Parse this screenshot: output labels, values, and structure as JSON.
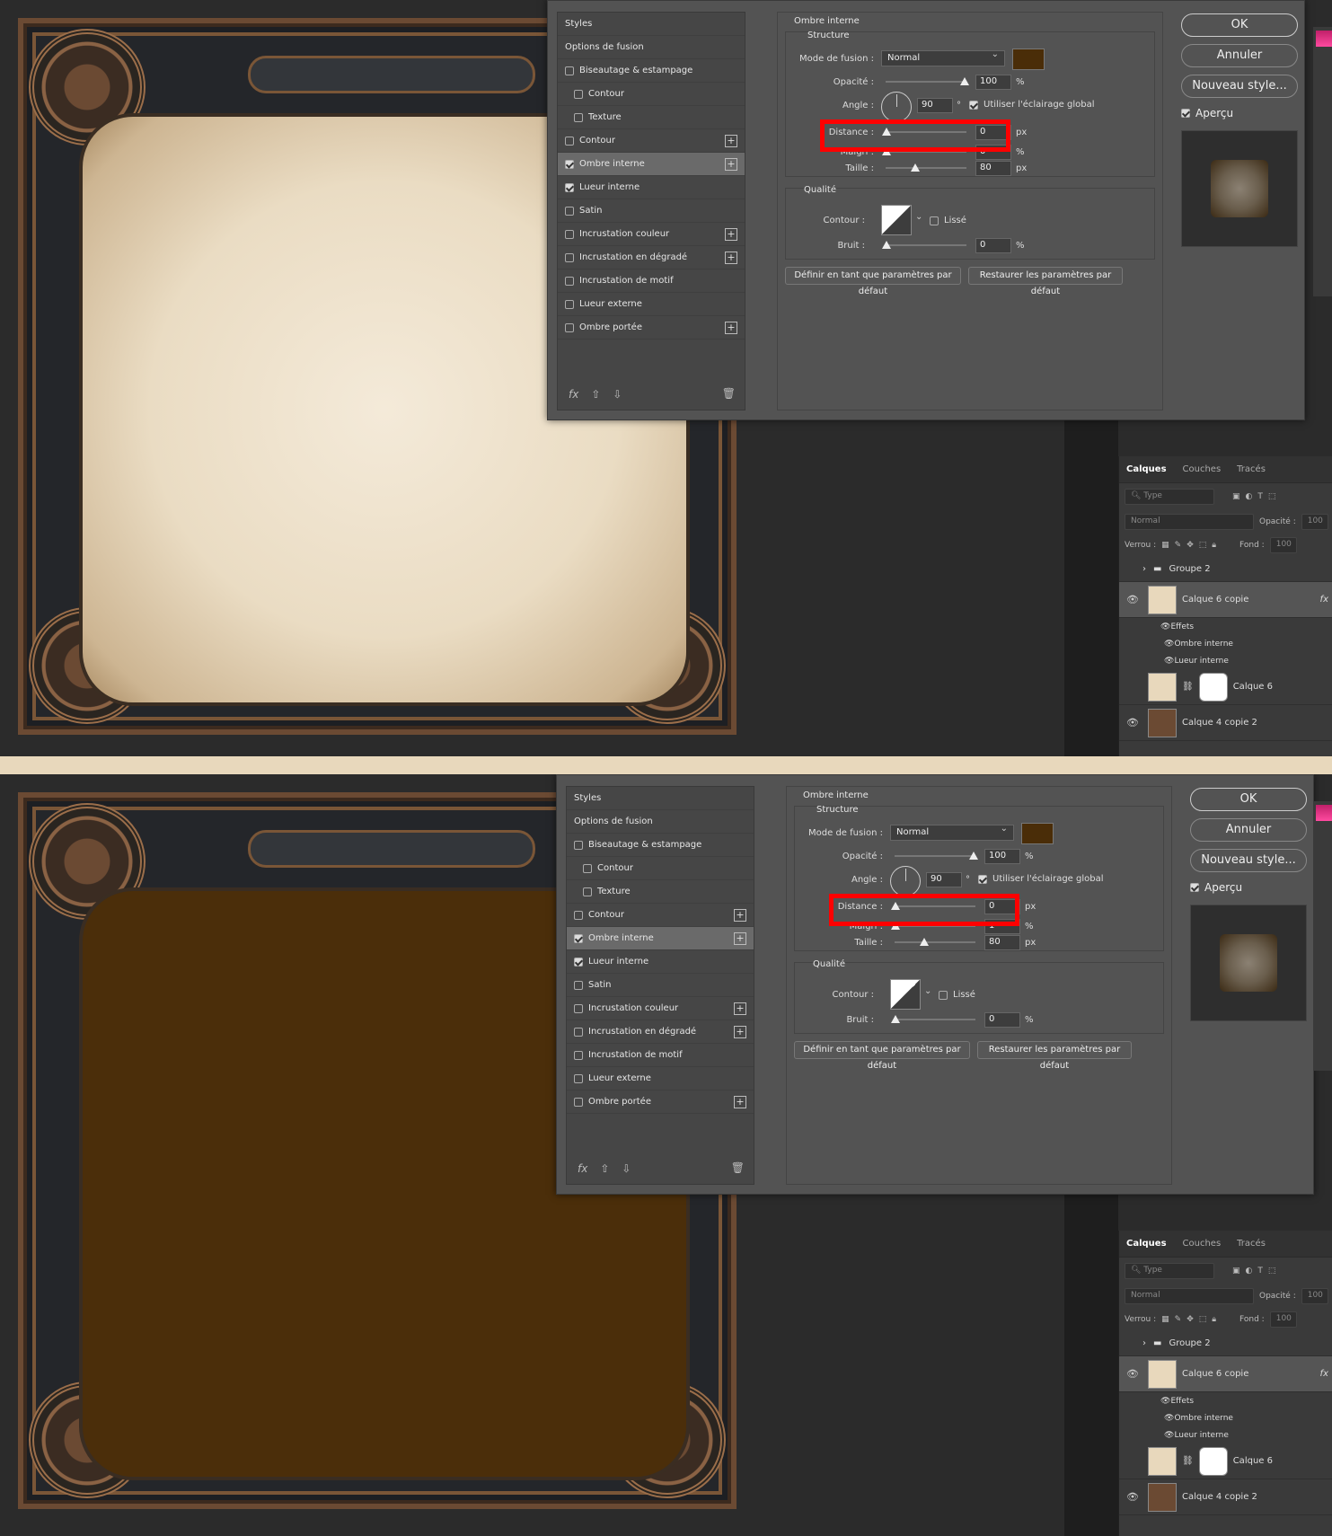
{
  "panels": [
    {
      "section_title": "Ombre interne",
      "structure_title": "Structure",
      "blend_label": "Mode de fusion :",
      "blend_value": "Normal",
      "swatch_color": "#4a2d08",
      "opacity_label": "Opacité :",
      "opacity_value": "100",
      "angle_label": "Angle :",
      "angle_value": "90",
      "global_light_label": "Utiliser l'éclairage global",
      "distance_label": "Distance :",
      "distance_value": "0",
      "maigri_label": "Maigri :",
      "maigri_value": "0",
      "taille_label": "Taille :",
      "taille_value": "80",
      "qualite_title": "Qualité",
      "contour_label": "Contour :",
      "lisse_label": "Lissé",
      "bruit_label": "Bruit :",
      "bruit_value": "0",
      "inner_color": "#efe3cf"
    },
    {
      "section_title": "Ombre interne",
      "structure_title": "Structure",
      "blend_label": "Mode de fusion :",
      "blend_value": "Normal",
      "swatch_color": "#4a2d08",
      "opacity_label": "Opacité :",
      "opacity_value": "100",
      "angle_label": "Angle :",
      "angle_value": "90",
      "global_light_label": "Utiliser l'éclairage global",
      "distance_label": "Distance :",
      "distance_value": "0",
      "maigri_label": "Maigri :",
      "maigri_value": "1",
      "taille_label": "Taille :",
      "taille_value": "80",
      "qualite_title": "Qualité",
      "contour_label": "Contour :",
      "lisse_label": "Lissé",
      "bruit_label": "Bruit :",
      "bruit_value": "0",
      "inner_color": "#4b2e0a"
    }
  ],
  "units": {
    "percent": "%",
    "px": "px",
    "degree": "°"
  },
  "styles_list": {
    "header": "Styles",
    "blend_options": "Options de fusion",
    "items": [
      {
        "label": "Biseautage & estampage",
        "checked": false,
        "sub": false,
        "plus": false
      },
      {
        "label": "Contour",
        "checked": false,
        "sub": true,
        "plus": false
      },
      {
        "label": "Texture",
        "checked": false,
        "sub": true,
        "plus": false
      },
      {
        "label": "Contour",
        "checked": false,
        "sub": false,
        "plus": true
      },
      {
        "label": "Ombre interne",
        "checked": true,
        "sub": false,
        "plus": true,
        "selected": true
      },
      {
        "label": "Lueur interne",
        "checked": true,
        "sub": false,
        "plus": false
      },
      {
        "label": "Satin",
        "checked": false,
        "sub": false,
        "plus": false
      },
      {
        "label": "Incrustation couleur",
        "checked": false,
        "sub": false,
        "plus": true
      },
      {
        "label": "Incrustation en dégradé",
        "checked": false,
        "sub": false,
        "plus": true
      },
      {
        "label": "Incrustation de motif",
        "checked": false,
        "sub": false,
        "plus": false
      },
      {
        "label": "Lueur externe",
        "checked": false,
        "sub": false,
        "plus": false
      },
      {
        "label": "Ombre portée",
        "checked": false,
        "sub": false,
        "plus": true
      }
    ],
    "fx_label": "fx"
  },
  "buttons": {
    "ok": "OK",
    "cancel": "Annuler",
    "new_style": "Nouveau style...",
    "preview": "Aperçu",
    "set_default": "Définir en tant que paramètres par défaut",
    "reset_default": "Restaurer les paramètres par défaut"
  },
  "layers_panel": {
    "tabs": [
      "Calques",
      "Couches",
      "Tracés"
    ],
    "search_placeholder": "Type",
    "blend_mode": "Normal",
    "opacity_label": "Opacité :",
    "opacity_value": "100",
    "lock_label": "Verrou :",
    "fill_label": "Fond :",
    "fill_value": "100",
    "layers": {
      "group": "Groupe 2",
      "layer_copy": "Calque 6 copie",
      "effects": "Effets",
      "effect1": "Ombre interne",
      "effect2": "Lueur interne",
      "layer6": "Calque 6",
      "layer4": "Calque 4 copie 2"
    }
  },
  "colors": {
    "highlight": "#ff0000",
    "accent_pink": "#e0307a"
  }
}
